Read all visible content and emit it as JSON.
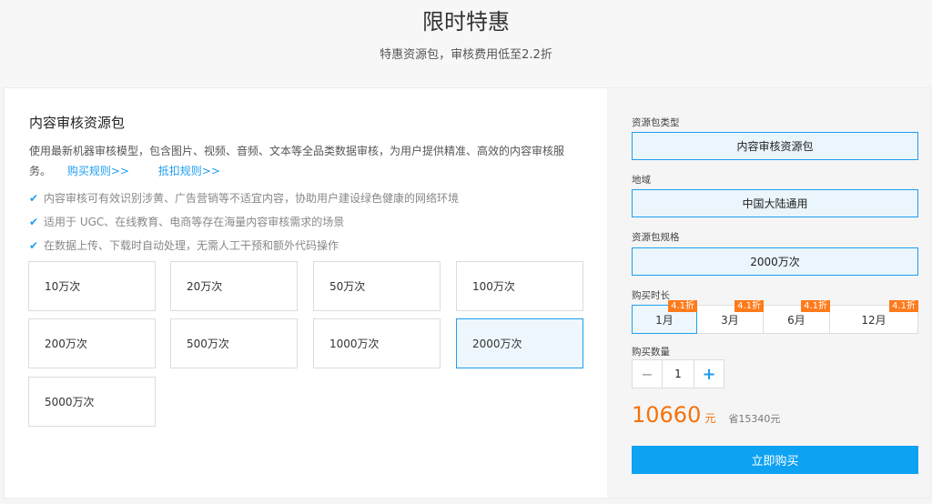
{
  "hero": {
    "title": "限时特惠",
    "subtitle": "特惠资源包，审核费用低至2.2折"
  },
  "package": {
    "title": "内容审核资源包",
    "description": "使用最新机器审核模型，包含图片、视频、音频、文本等全品类数据审核，为用户提供精准、高效的内容审核服务。",
    "links": {
      "purchase_rules": "购买规则>>",
      "deduction_rules": "抵扣规则>>"
    },
    "features": [
      "内容审核可有效识别涉黄、广告营销等不适宜内容，协助用户建设绿色健康的网络环境",
      "适用于 UGC、在线教育、电商等存在海量内容审核需求的场景",
      "在数据上传、下载时自动处理，无需人工干预和额外代码操作"
    ],
    "options": [
      "10万次",
      "20万次",
      "50万次",
      "100万次",
      "200万次",
      "500万次",
      "1000万次",
      "2000万次",
      "5000万次"
    ],
    "selected_option": "2000万次"
  },
  "order": {
    "type_label": "资源包类型",
    "type_value": "内容审核资源包",
    "region_label": "地域",
    "region_value": "中国大陆通用",
    "spec_label": "资源包规格",
    "spec_value": "2000万次",
    "duration_label": "购买时长",
    "durations": [
      {
        "label": "1月",
        "tag": "4.1折"
      },
      {
        "label": "3月",
        "tag": "4.1折"
      },
      {
        "label": "6月",
        "tag": "4.1折"
      },
      {
        "label": "12月",
        "tag": "4.1折"
      }
    ],
    "selected_duration": "1月",
    "quantity_label": "购买数量",
    "quantity": "1",
    "minus": "−",
    "plus": "+",
    "price": "10660",
    "price_unit": "元",
    "saving": "省15340元",
    "buy_label": "立即购买"
  },
  "colors": {
    "accent": "#1e9ef0",
    "price": "#f5720a",
    "tag": "#ff7a1a",
    "buy": "#0ea2f2"
  }
}
